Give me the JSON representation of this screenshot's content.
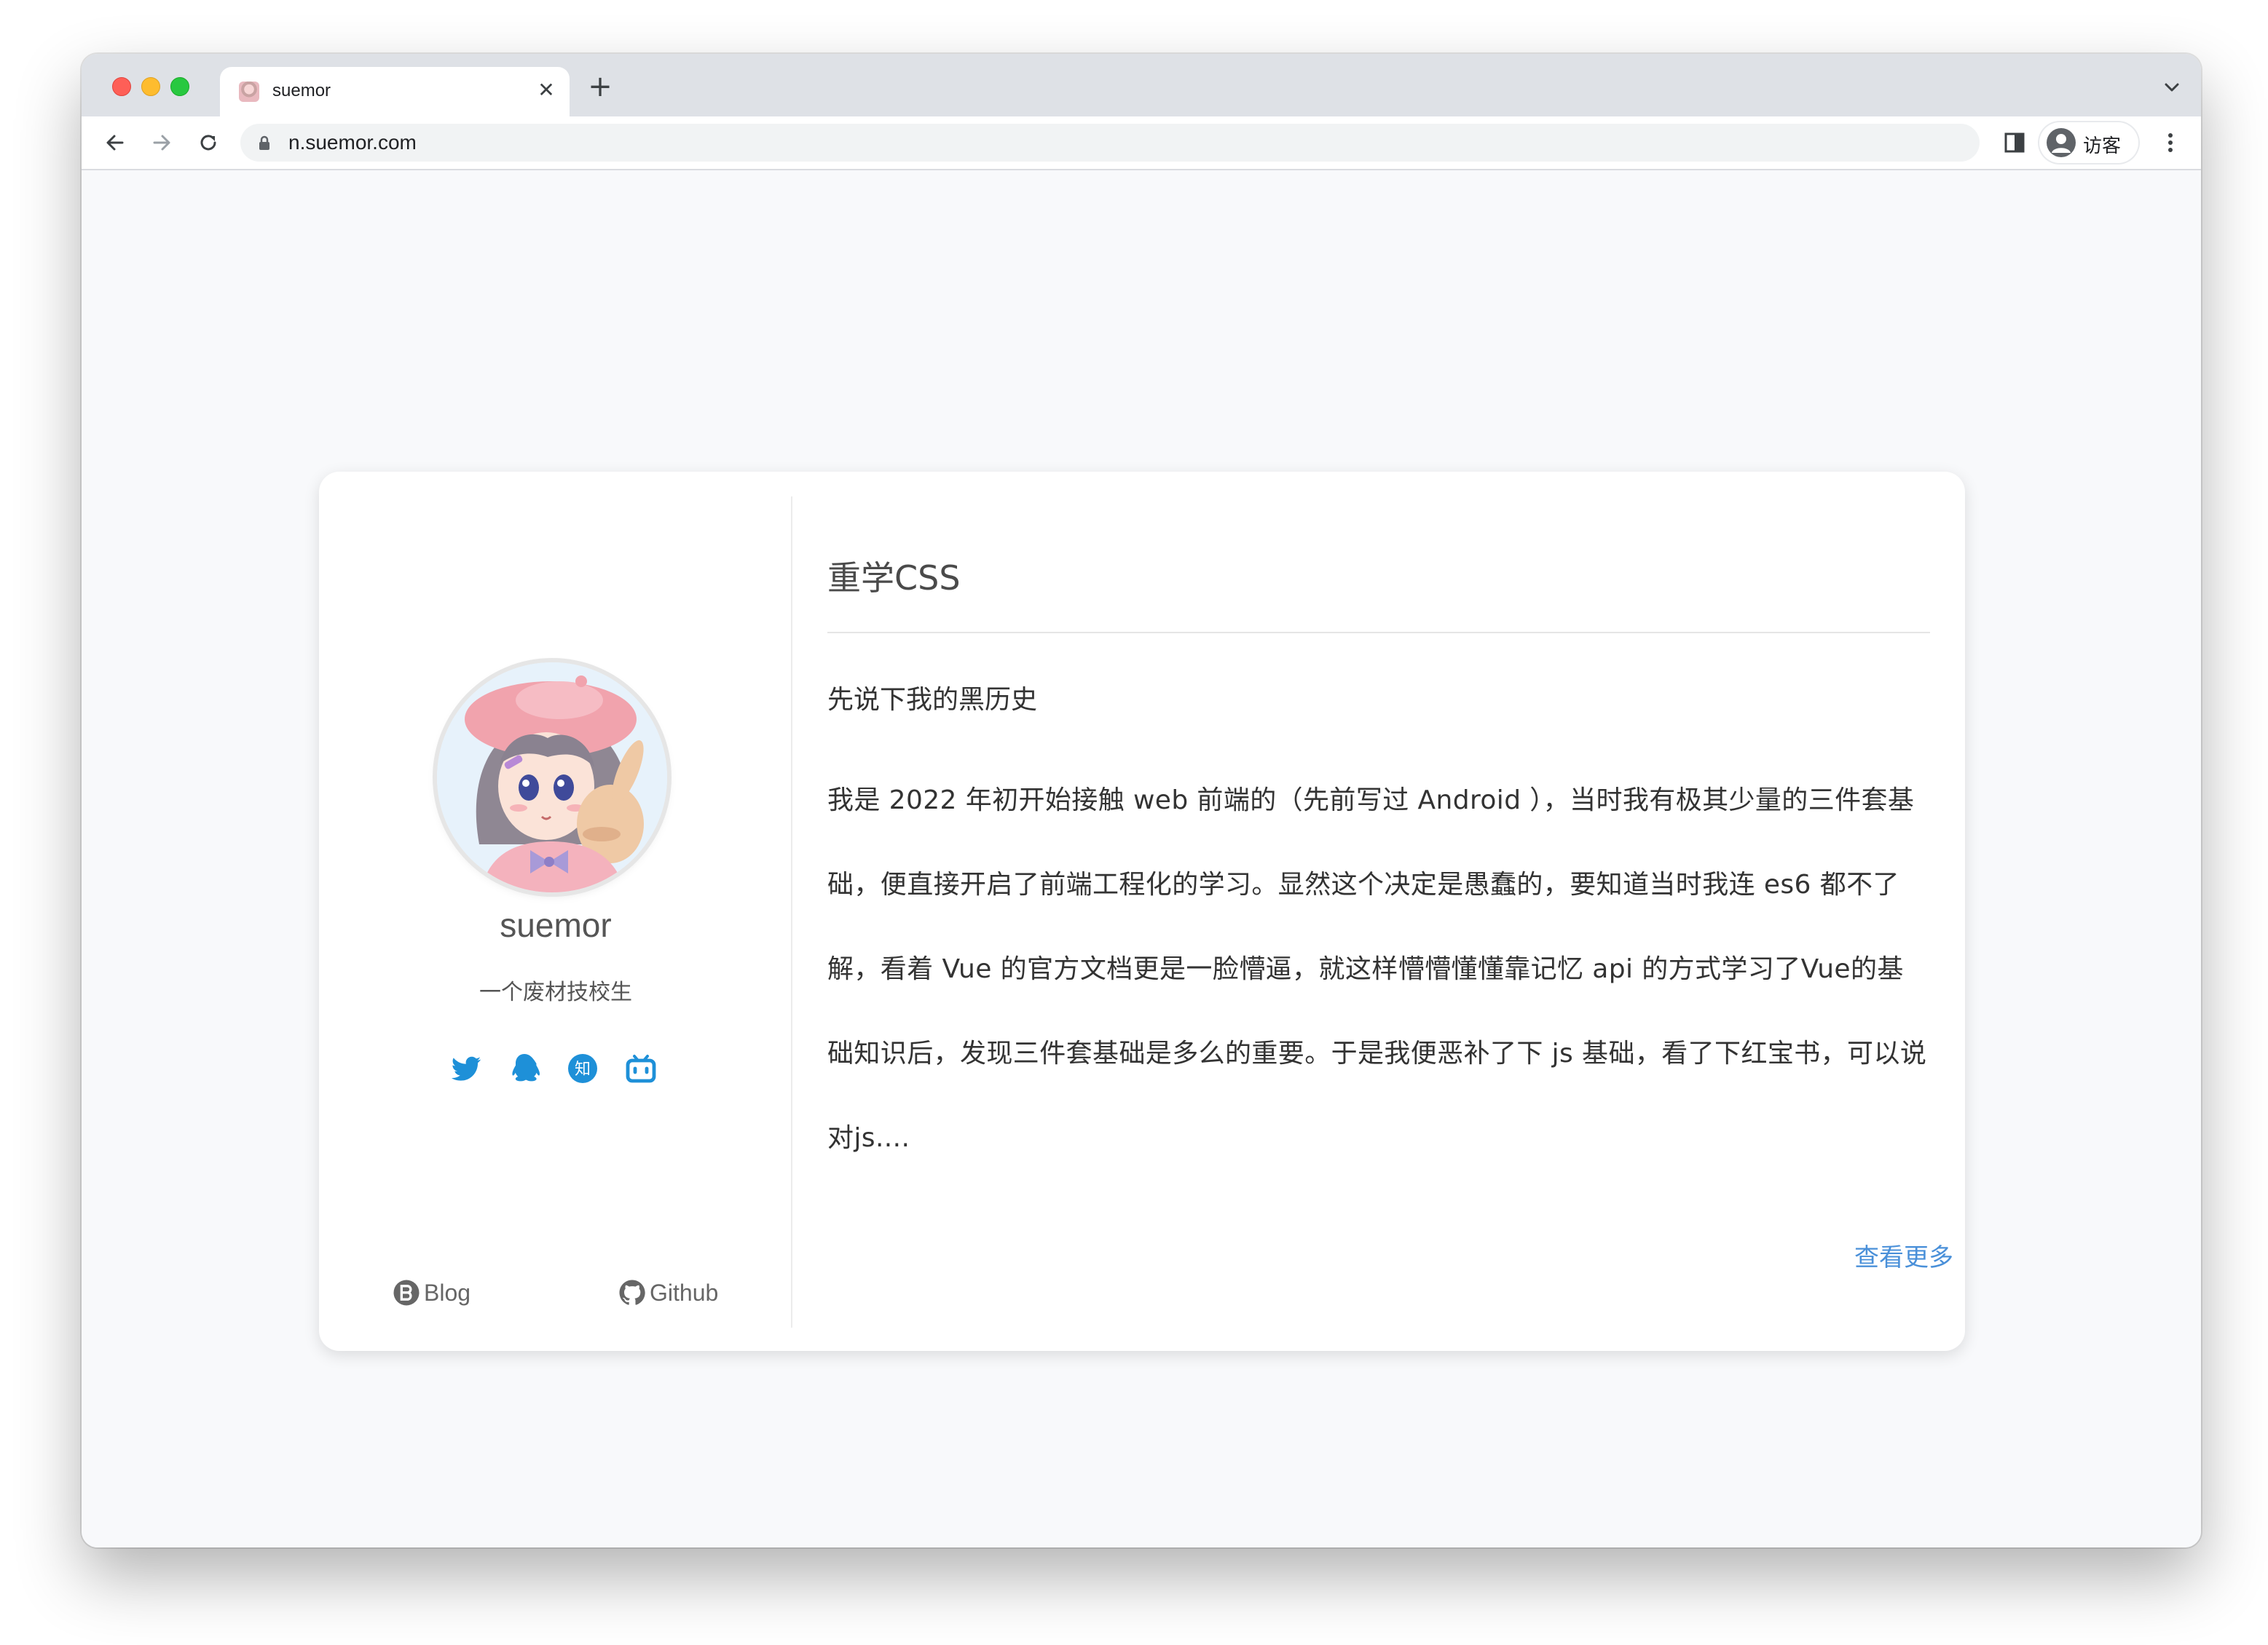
{
  "browser": {
    "tab_title": "suemor",
    "tab_close": "✕",
    "new_tab": "+",
    "url": "n.suemor.com",
    "profile_label": "访客"
  },
  "profile": {
    "name": "suemor",
    "bio": "一个废材技校生",
    "socials": [
      "twitter-icon",
      "qq-icon",
      "zhihu-icon",
      "bilibili-icon"
    ],
    "zhihu_glyph": "知",
    "blog_label": "Blog",
    "github_label": "Github"
  },
  "post": {
    "title": "重学CSS",
    "intro": "先说下我的黑历史",
    "body": "我是 2022 年初开始接触 web 前端的（先前写过 Android ），当时我有极其少量的三件套基础，便直接开启了前端工程化的学习。显然这个决定是愚蠢的，要知道当时我连 es6 都不了解，看着 Vue 的官方文档更是一脸懵逼，就这样懵懵懂懂靠记忆 api 的方式学习了Vue的基础知识后，发现三件套基础是多么的重要。于是我便恶补了下 js 基础，看了下红宝书，可以说对js....",
    "read_more": "查看更多"
  },
  "colors": {
    "accent": "#4a90d9",
    "social_icon": "#1e90d8"
  }
}
